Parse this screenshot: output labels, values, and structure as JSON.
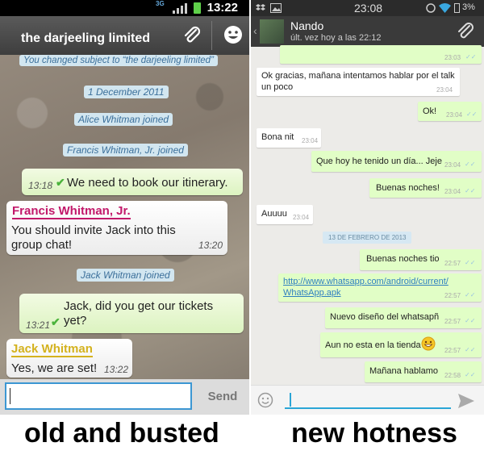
{
  "left": {
    "status_time": "13:22",
    "network_label": "3G",
    "title": "the darjeeling limited",
    "system_messages": [
      "You changed subject to “the darjeeling limited”",
      "1 December 2011",
      "Alice Whitman joined",
      "Francis Whitman, Jr. joined",
      "Jack Whitman joined"
    ],
    "messages": [
      {
        "text": "We need to book our itinerary.",
        "time": "13:18"
      },
      {
        "sender": "Francis Whitman, Jr.",
        "text1": "You should invite Jack into this",
        "text2": "group chat!",
        "time": "13:20"
      },
      {
        "text1": "Jack, did you get our tickets",
        "text2": "yet?",
        "time": "13:21"
      },
      {
        "sender": "Jack Whitman",
        "text": "Yes, we are set!",
        "time": "13:22"
      }
    ],
    "input_value": "",
    "send_label": "Send",
    "sender_colors": {
      "francis": "#c2186a",
      "jack": "#d4b21e"
    },
    "caption": "old and busted"
  },
  "right": {
    "status_time": "23:08",
    "battery": "3%",
    "contact_name": "Nando",
    "last_seen": "últ. vez hoy a las 22:12",
    "messages": [
      {
        "dir": "out",
        "text": "",
        "time": "23:03"
      },
      {
        "dir": "in",
        "text1": "Ok gracias, mañana intentamos hablar por el talk",
        "text2": "un poco",
        "time": "23:04"
      },
      {
        "dir": "out",
        "text": "Ok!",
        "time": "23:04"
      },
      {
        "dir": "in",
        "text": "Bona nit",
        "time": "23:04"
      },
      {
        "dir": "out",
        "text": "Que hoy he tenido un día... Jeje",
        "time": "23:04"
      },
      {
        "dir": "out",
        "text": "Buenas noches!",
        "time": "23:04"
      },
      {
        "dir": "in",
        "text": "Auuuu",
        "time": "23:04"
      },
      {
        "dir": "out",
        "text": "Buenas noches tio",
        "time": "22:57"
      },
      {
        "dir": "out",
        "link1": "http://www.whatsapp.com/android/current/",
        "link2": "WhatsApp.apk",
        "time": "22:57"
      },
      {
        "dir": "out",
        "text": "Nuevo diseño del whatsapñ",
        "time": "22:57"
      },
      {
        "dir": "out",
        "text": "Aun no esta en la tienda",
        "time": "22:57"
      },
      {
        "dir": "out",
        "text": "Mañana hablamo",
        "time": "22:58"
      }
    ],
    "date_divider": "13 DE FEBRERO DE 2013",
    "input_value": "",
    "caption": "new hotness"
  }
}
